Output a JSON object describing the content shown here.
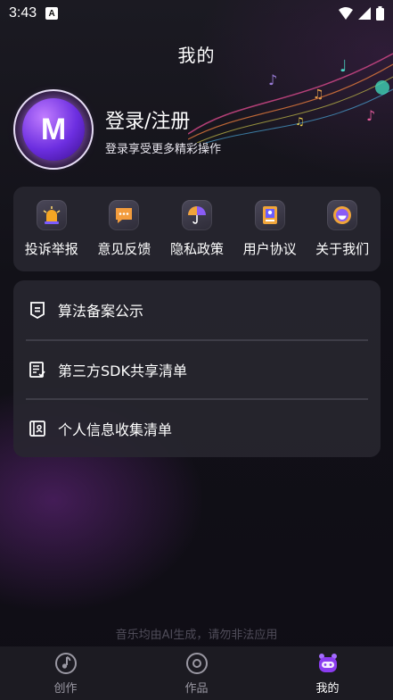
{
  "status_bar": {
    "time": "3:43",
    "notification_badge": "A"
  },
  "page": {
    "title": "我的"
  },
  "profile": {
    "avatar_letter": "M",
    "login_title": "登录/注册",
    "login_subtitle": "登录享受更多精彩操作"
  },
  "quick_actions": [
    {
      "label": "投诉举报",
      "icon": "alarm-light-icon"
    },
    {
      "label": "意见反馈",
      "icon": "chat-bubble-icon"
    },
    {
      "label": "隐私政策",
      "icon": "umbrella-icon"
    },
    {
      "label": "用户协议",
      "icon": "document-portrait-icon"
    },
    {
      "label": "关于我们",
      "icon": "smiley-face-icon"
    }
  ],
  "list_items": [
    {
      "label": "算法备案公示",
      "icon": "shield-list-icon"
    },
    {
      "label": "第三方SDK共享清单",
      "icon": "checklist-icon"
    },
    {
      "label": "个人信息收集清单",
      "icon": "contact-book-icon"
    }
  ],
  "disclaimer": "音乐均由AI生成，请勿非法应用",
  "bottom_nav": {
    "items": [
      {
        "label": "创作",
        "icon": "music-note-circle-icon"
      },
      {
        "label": "作品",
        "icon": "disc-icon"
      },
      {
        "label": "我的",
        "icon": "robot-face-icon"
      }
    ],
    "active_index": 2
  },
  "colors": {
    "accent": "#8b3cf0",
    "card_bg": "#28272f",
    "text": "#ffffff",
    "muted": "#9a98a3"
  }
}
